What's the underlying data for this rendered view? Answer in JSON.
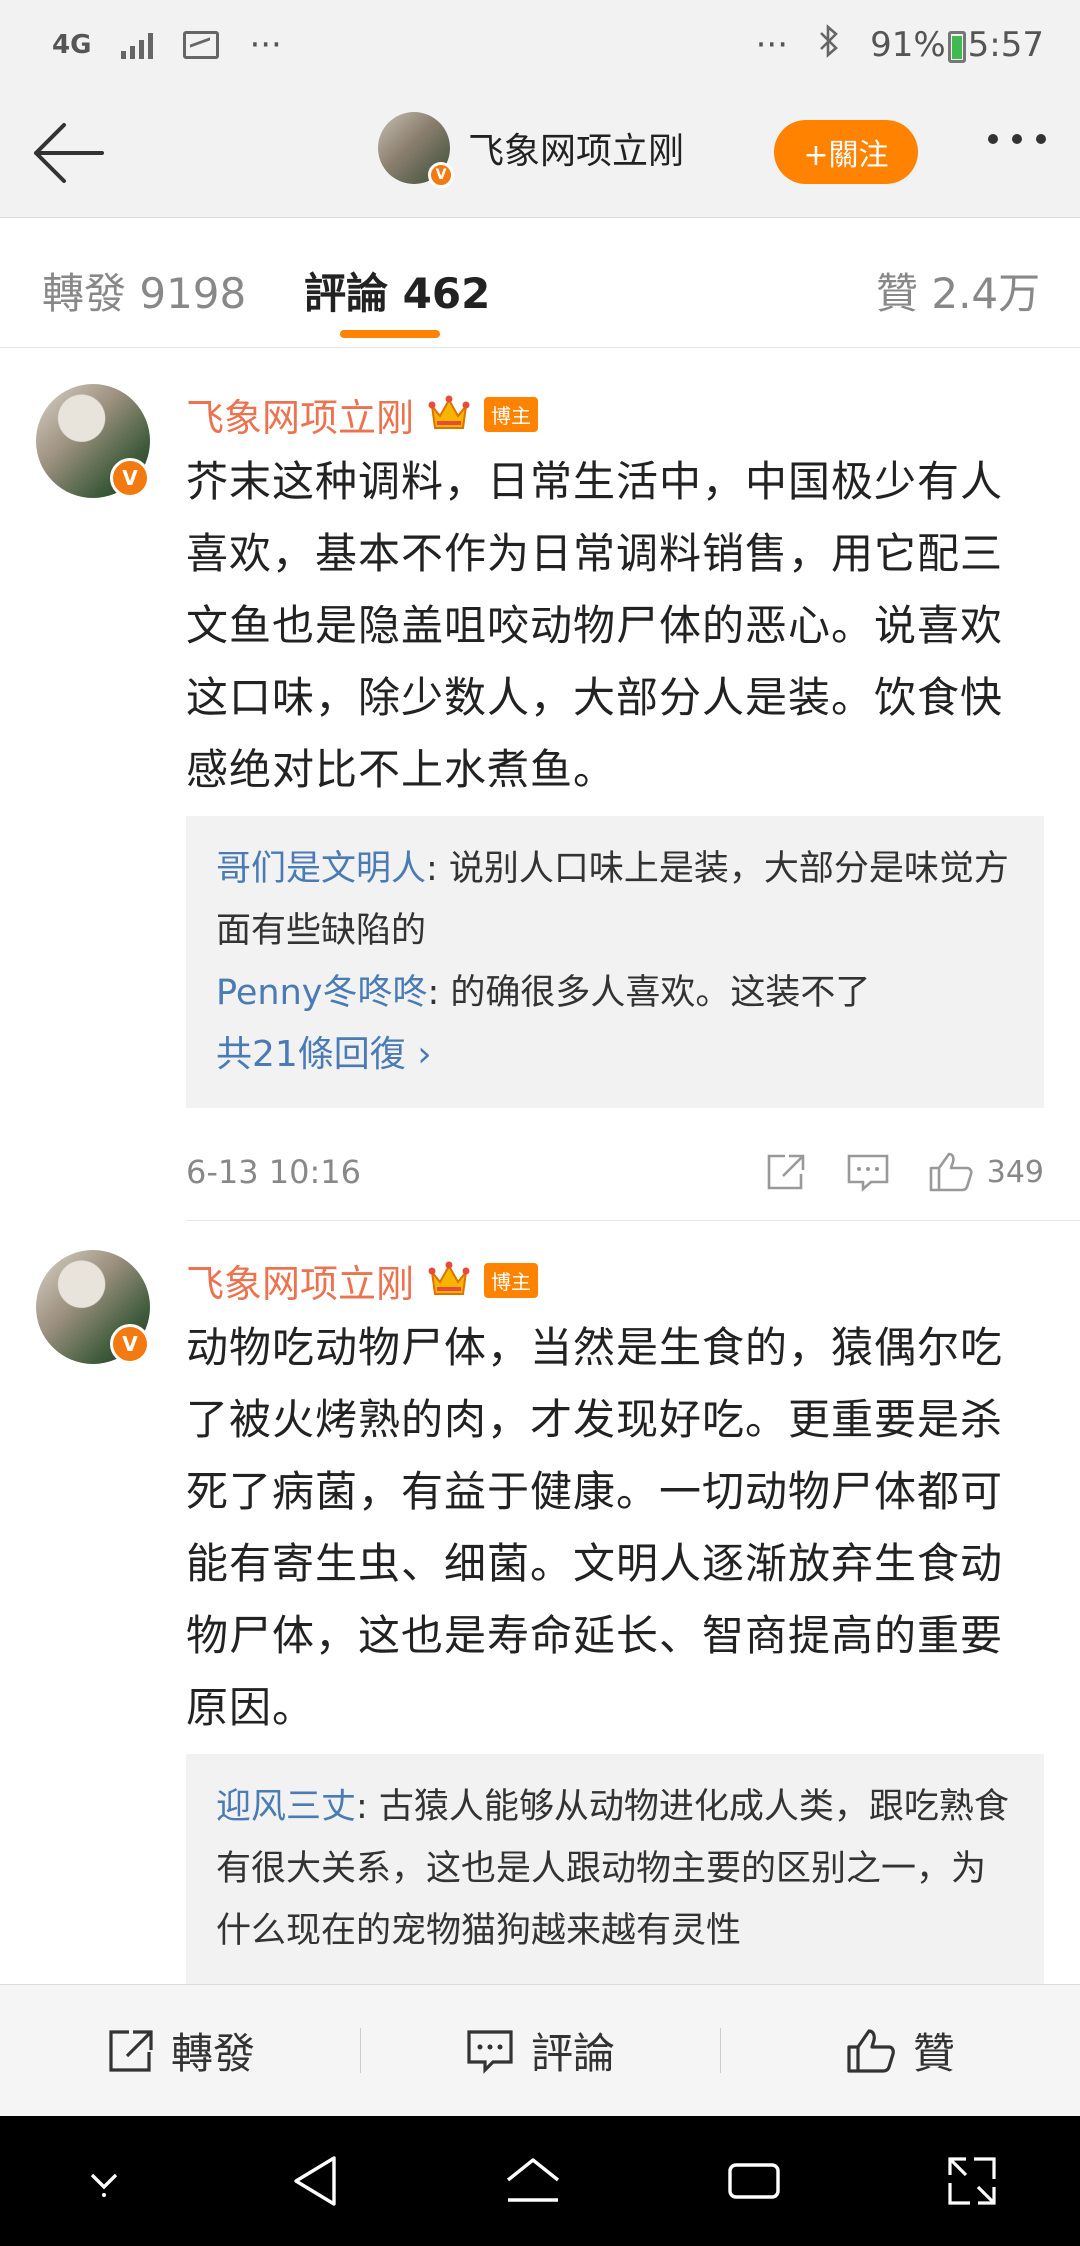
{
  "status": {
    "network": "4G",
    "notif_more": "···",
    "sys_more": "···",
    "battery": "91%",
    "time": "5:57"
  },
  "header": {
    "title": "飞象网项立刚",
    "follow_label": "+關注"
  },
  "tabs": [
    {
      "label": "轉發 9198"
    },
    {
      "label": "評論 462"
    },
    {
      "label": "贊 2.4万"
    }
  ],
  "comments": [
    {
      "author": "飞象网项立刚",
      "badge": "博主",
      "text": "芥末这种调料，日常生活中，中国极少有人喜欢，基本不作为日常调料销售，用它配三文鱼也是隐盖咀咬动物尸体的恶心。说喜欢这口味，除少数人，大部分人是装。饮食快感绝对比不上水煮鱼。",
      "replies": [
        {
          "user": "哥们是文明人",
          "text": ": 说别人口味上是装，大部分是味觉方面有些缺陷的"
        },
        {
          "user": "Penny冬咚咚",
          "text": ": 的确很多人喜欢。这装不了"
        }
      ],
      "more_replies": "共21條回復 ›",
      "time": "6-13 10:16",
      "likes": "349"
    },
    {
      "author": "飞象网项立刚",
      "badge": "博主",
      "text": "动物吃动物尸体，当然是生食的，猿偶尔吃了被火烤熟的肉，才发现好吃。更重要是杀死了病菌，有益于健康。一切动物尸体都可能有寄生虫、细菌。文明人逐渐放弃生食动物尸体，这也是寿命延长、智商提高的重要原因。",
      "replies": [
        {
          "user": "迎风三丈",
          "text": ": 古猿人能够从动物进化成人类，跟吃熟食有很大关系，这也是人跟动物主要的区别之一，为什么现在的宠物猫狗越来越有灵性"
        }
      ]
    }
  ],
  "actionbar": {
    "repost": "轉發",
    "comment": "評論",
    "like": "贊"
  },
  "colors": {
    "accent": "#ff8200",
    "username": "#eb7350",
    "link": "#4a7bb5"
  }
}
